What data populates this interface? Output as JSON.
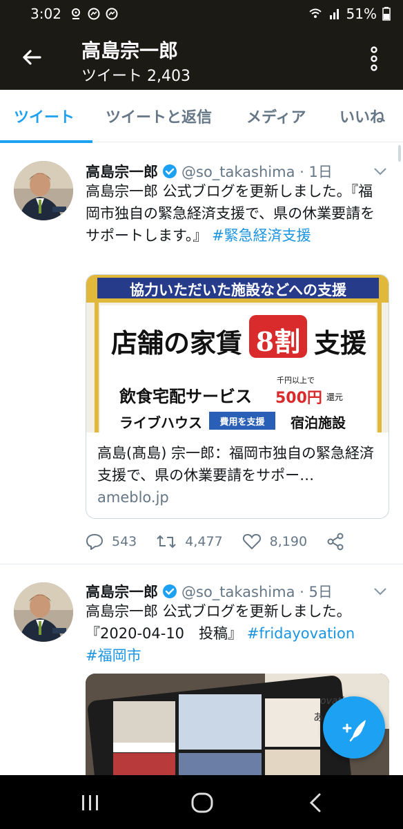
{
  "status_bar": {
    "time": "3:02",
    "battery": "51%"
  },
  "header": {
    "title": "高島宗一郎",
    "subtitle": "ツイート 2,403"
  },
  "tabs": [
    {
      "label": "ツイート",
      "active": true
    },
    {
      "label": "ツイートと返信",
      "active": false
    },
    {
      "label": "メディア",
      "active": false
    },
    {
      "label": "いいね",
      "active": false
    }
  ],
  "tweets": [
    {
      "name": "高島宗一郎",
      "handle": "@so_takashima · 1日",
      "text_plain": "高島宗一郎 公式ブログを更新しました。『福岡市独自の緊急経済支援で、県の休業要請をサポートします。』 ",
      "hashtag": "#緊急経済支援",
      "card": {
        "image_banner": "協力いただいた施設などへの支援",
        "image_headline_pre": "店舗の家賃",
        "image_headline_badge": "8割",
        "image_headline_post": "支援",
        "image_row1_left": "飲食宅配サービス",
        "image_row1_small": "千円以上で",
        "image_row1_amount": "500円",
        "image_row1_suffix": "還元",
        "image_row2_left": "ライブハウス",
        "image_row2_badge": "費用を支援",
        "image_row2_right": "宿泊施設",
        "title": "高島(髙島) 宗一郎：福岡市独自の緊急経済支援で、県の休業要請をサポー…",
        "domain": "ameblo.jp"
      },
      "replies": "543",
      "retweets": "4,477",
      "likes": "8,190"
    },
    {
      "name": "高島宗一郎",
      "handle": "@so_takashima · 5日",
      "text_plain": "高島宗一郎 公式ブログを更新しました。『2020-04-10　投稿』 ",
      "hashtag1": "#fridayovation",
      "hashtag2": "#福岡市",
      "photo_text_1": "ovation",
      "photo_text_2": "ありがとう"
    }
  ],
  "colors": {
    "accent": "#1da1f2",
    "header_bg": "#1c1a14",
    "text": "#14171a",
    "secondary": "#657786"
  }
}
